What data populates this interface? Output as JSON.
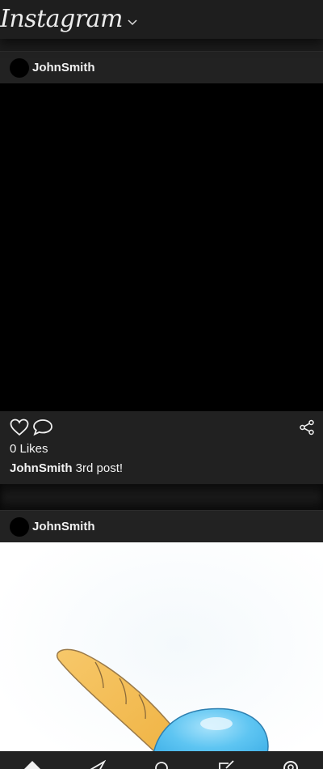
{
  "header": {
    "logo": "Instagram",
    "dropdown_icon": "chevron-down-icon"
  },
  "posts": [
    {
      "username": "JohnSmith",
      "likes": "0 Likes",
      "caption_user": "JohnSmith",
      "caption_text": " 3rd post!",
      "media": "black"
    },
    {
      "username": "JohnSmith",
      "media": "drawing"
    }
  ],
  "icons": {
    "like": "heart-icon",
    "comment": "comment-icon",
    "share": "share-icon"
  },
  "bottom_nav": [
    "home-icon",
    "send-icon",
    "search-icon",
    "edit-icon",
    "profile-icon"
  ],
  "colors": {
    "background": "#1c1c1c",
    "card": "#212121",
    "text": "#f2f2f2",
    "bread": "#f6c35c",
    "blob": "#5cc3f1"
  }
}
